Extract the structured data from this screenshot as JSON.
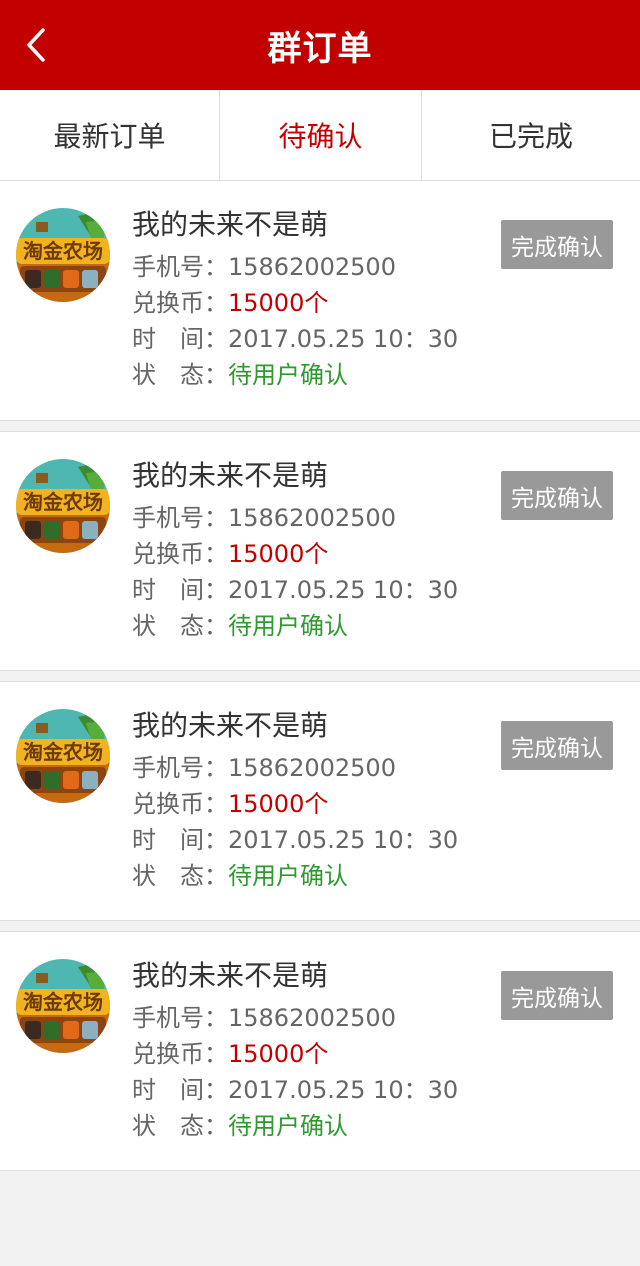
{
  "header": {
    "title": "群订单"
  },
  "tabs": [
    {
      "label": "最新订单"
    },
    {
      "label": "待确认"
    },
    {
      "label": "已完成"
    }
  ],
  "colors": {
    "brand": "#c30000",
    "status_green": "#2e9a2e",
    "button_gray": "#999999"
  },
  "labels": {
    "phone": "手机号：",
    "coins": "兑换币：",
    "time": "时　间：",
    "status": "状　态："
  },
  "orders": [
    {
      "name": "我的未来不是萌",
      "phone": "15862002500",
      "coins": "15000个",
      "time": "2017.05.25 10：30",
      "status": "待用户确认",
      "button": "完成确认"
    },
    {
      "name": "我的未来不是萌",
      "phone": "15862002500",
      "coins": "15000个",
      "time": "2017.05.25 10：30",
      "status": "待用户确认",
      "button": "完成确认"
    },
    {
      "name": "我的未来不是萌",
      "phone": "15862002500",
      "coins": "15000个",
      "time": "2017.05.25 10：30",
      "status": "待用户确认",
      "button": "完成确认"
    },
    {
      "name": "我的未来不是萌",
      "phone": "15862002500",
      "coins": "15000个",
      "time": "2017.05.25 10：30",
      "status": "待用户确认",
      "button": "完成确认"
    }
  ]
}
